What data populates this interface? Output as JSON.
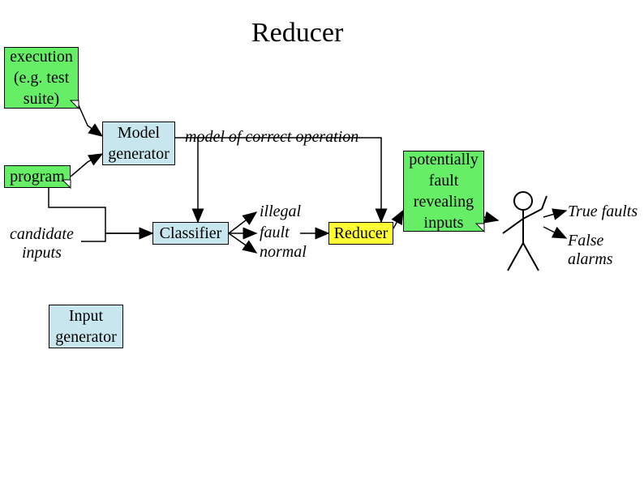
{
  "title": "Reducer",
  "boxes": {
    "execution": "execution\n(e.g. test\nsuite)",
    "program": "program",
    "model_generator": "Model\ngenerator",
    "classifier": "Classifier",
    "reducer": "Reducer",
    "potentially": "potentially\nfault\nrevealing\ninputs",
    "input_generator": "Input\ngenerator"
  },
  "labels": {
    "candidate_inputs": "candidate\ninputs",
    "model_correct": "model of correct operation",
    "illegal": "illegal",
    "fault": "fault",
    "normal": "normal",
    "true_faults": "True faults",
    "false_alarms": "False alarms"
  }
}
